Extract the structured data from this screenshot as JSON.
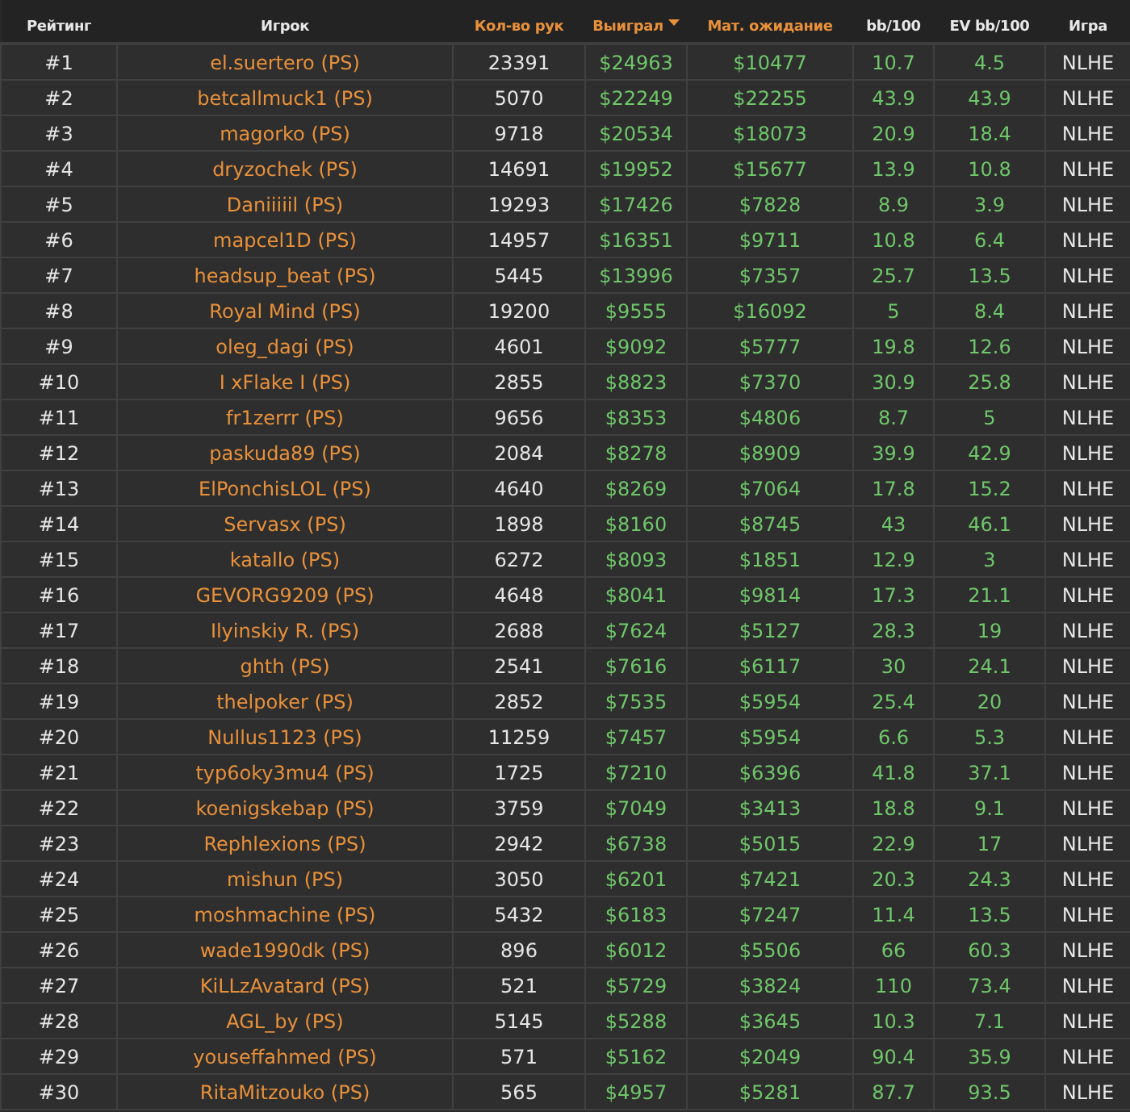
{
  "table": {
    "columns": [
      {
        "label": "Рейтинг",
        "kind": "plain",
        "sortable": false,
        "sorted": false
      },
      {
        "label": "Игрок",
        "kind": "player",
        "sortable": false,
        "sorted": false
      },
      {
        "label": "Кол-во рук",
        "kind": "plain",
        "sortable": true,
        "sorted": false
      },
      {
        "label": "Выиграл",
        "kind": "money",
        "sortable": true,
        "sorted": true
      },
      {
        "label": "Мат. ожидание",
        "kind": "money",
        "sortable": true,
        "sorted": false
      },
      {
        "label": "bb/100",
        "kind": "money",
        "sortable": false,
        "sorted": false
      },
      {
        "label": "EV bb/100",
        "kind": "money",
        "sortable": false,
        "sorted": false
      },
      {
        "label": "Игра",
        "kind": "plain",
        "sortable": false,
        "sorted": false
      }
    ],
    "rows": [
      [
        "#1",
        "el.suertero (PS)",
        "23391",
        "$24963",
        "$10477",
        "10.7",
        "4.5",
        "NLHE"
      ],
      [
        "#2",
        "betcallmuck1 (PS)",
        "5070",
        "$22249",
        "$22255",
        "43.9",
        "43.9",
        "NLHE"
      ],
      [
        "#3",
        "magorko (PS)",
        "9718",
        "$20534",
        "$18073",
        "20.9",
        "18.4",
        "NLHE"
      ],
      [
        "#4",
        "dryzochek (PS)",
        "14691",
        "$19952",
        "$15677",
        "13.9",
        "10.8",
        "NLHE"
      ],
      [
        "#5",
        "Daniiiiil (PS)",
        "19293",
        "$17426",
        "$7828",
        "8.9",
        "3.9",
        "NLHE"
      ],
      [
        "#6",
        "mapcel1D (PS)",
        "14957",
        "$16351",
        "$9711",
        "10.8",
        "6.4",
        "NLHE"
      ],
      [
        "#7",
        "headsup_beat (PS)",
        "5445",
        "$13996",
        "$7357",
        "25.7",
        "13.5",
        "NLHE"
      ],
      [
        "#8",
        "Royal Mind (PS)",
        "19200",
        "$9555",
        "$16092",
        "5",
        "8.4",
        "NLHE"
      ],
      [
        "#9",
        "oleg_dagi (PS)",
        "4601",
        "$9092",
        "$5777",
        "19.8",
        "12.6",
        "NLHE"
      ],
      [
        "#10",
        "I xFlake I (PS)",
        "2855",
        "$8823",
        "$7370",
        "30.9",
        "25.8",
        "NLHE"
      ],
      [
        "#11",
        "fr1zerrr (PS)",
        "9656",
        "$8353",
        "$4806",
        "8.7",
        "5",
        "NLHE"
      ],
      [
        "#12",
        "paskuda89 (PS)",
        "2084",
        "$8278",
        "$8909",
        "39.9",
        "42.9",
        "NLHE"
      ],
      [
        "#13",
        "ElPonchisLOL (PS)",
        "4640",
        "$8269",
        "$7064",
        "17.8",
        "15.2",
        "NLHE"
      ],
      [
        "#14",
        "Servasx (PS)",
        "1898",
        "$8160",
        "$8745",
        "43",
        "46.1",
        "NLHE"
      ],
      [
        "#15",
        "katallo (PS)",
        "6272",
        "$8093",
        "$1851",
        "12.9",
        "3",
        "NLHE"
      ],
      [
        "#16",
        "GEVORG9209 (PS)",
        "4648",
        "$8041",
        "$9814",
        "17.3",
        "21.1",
        "NLHE"
      ],
      [
        "#17",
        "Ilyinskiy R. (PS)",
        "2688",
        "$7624",
        "$5127",
        "28.3",
        "19",
        "NLHE"
      ],
      [
        "#18",
        "ghth (PS)",
        "2541",
        "$7616",
        "$6117",
        "30",
        "24.1",
        "NLHE"
      ],
      [
        "#19",
        "thelpoker (PS)",
        "2852",
        "$7535",
        "$5954",
        "25.4",
        "20",
        "NLHE"
      ],
      [
        "#20",
        "Nullus1123 (PS)",
        "11259",
        "$7457",
        "$5954",
        "6.6",
        "5.3",
        "NLHE"
      ],
      [
        "#21",
        "typ6oky3mu4 (PS)",
        "1725",
        "$7210",
        "$6396",
        "41.8",
        "37.1",
        "NLHE"
      ],
      [
        "#22",
        "koenigskebap (PS)",
        "3759",
        "$7049",
        "$3413",
        "18.8",
        "9.1",
        "NLHE"
      ],
      [
        "#23",
        "Rephlexions (PS)",
        "2942",
        "$6738",
        "$5015",
        "22.9",
        "17",
        "NLHE"
      ],
      [
        "#24",
        "mishun (PS)",
        "3050",
        "$6201",
        "$7421",
        "20.3",
        "24.3",
        "NLHE"
      ],
      [
        "#25",
        "moshmachine (PS)",
        "5432",
        "$6183",
        "$7247",
        "11.4",
        "13.5",
        "NLHE"
      ],
      [
        "#26",
        "wade1990dk (PS)",
        "896",
        "$6012",
        "$5506",
        "66",
        "60.3",
        "NLHE"
      ],
      [
        "#27",
        "KiLLzAvatard (PS)",
        "521",
        "$5729",
        "$3824",
        "110",
        "73.4",
        "NLHE"
      ],
      [
        "#28",
        "AGL_by (PS)",
        "5145",
        "$5288",
        "$3645",
        "10.3",
        "7.1",
        "NLHE"
      ],
      [
        "#29",
        "youseffahmed (PS)",
        "571",
        "$5162",
        "$2049",
        "90.4",
        "35.9",
        "NLHE"
      ],
      [
        "#30",
        "RitaMitzouko (PS)",
        "565",
        "$4957",
        "$5281",
        "87.7",
        "93.5",
        "NLHE"
      ]
    ]
  }
}
